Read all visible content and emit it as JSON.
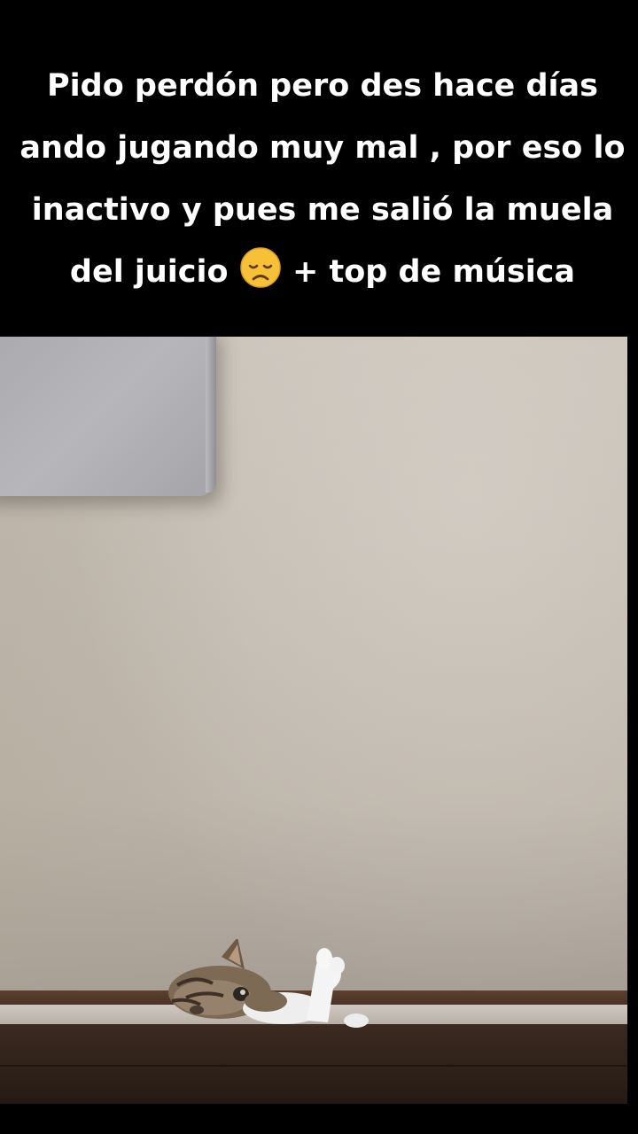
{
  "caption": {
    "before_emoji": "Pido perdón pero des hace días ando jugando muy mal , por eso lo inactivo y pues me salió la muela del juicio ",
    "emoji": "disappointed-face-icon",
    "after_emoji": " + top de música"
  },
  "video": {
    "scene": "cat-peeking-over-shelf",
    "colors": {
      "wall": "#c3bcb2",
      "shelf": "#3b2a20",
      "tv": "#b0afb3",
      "background": "#000000"
    }
  }
}
